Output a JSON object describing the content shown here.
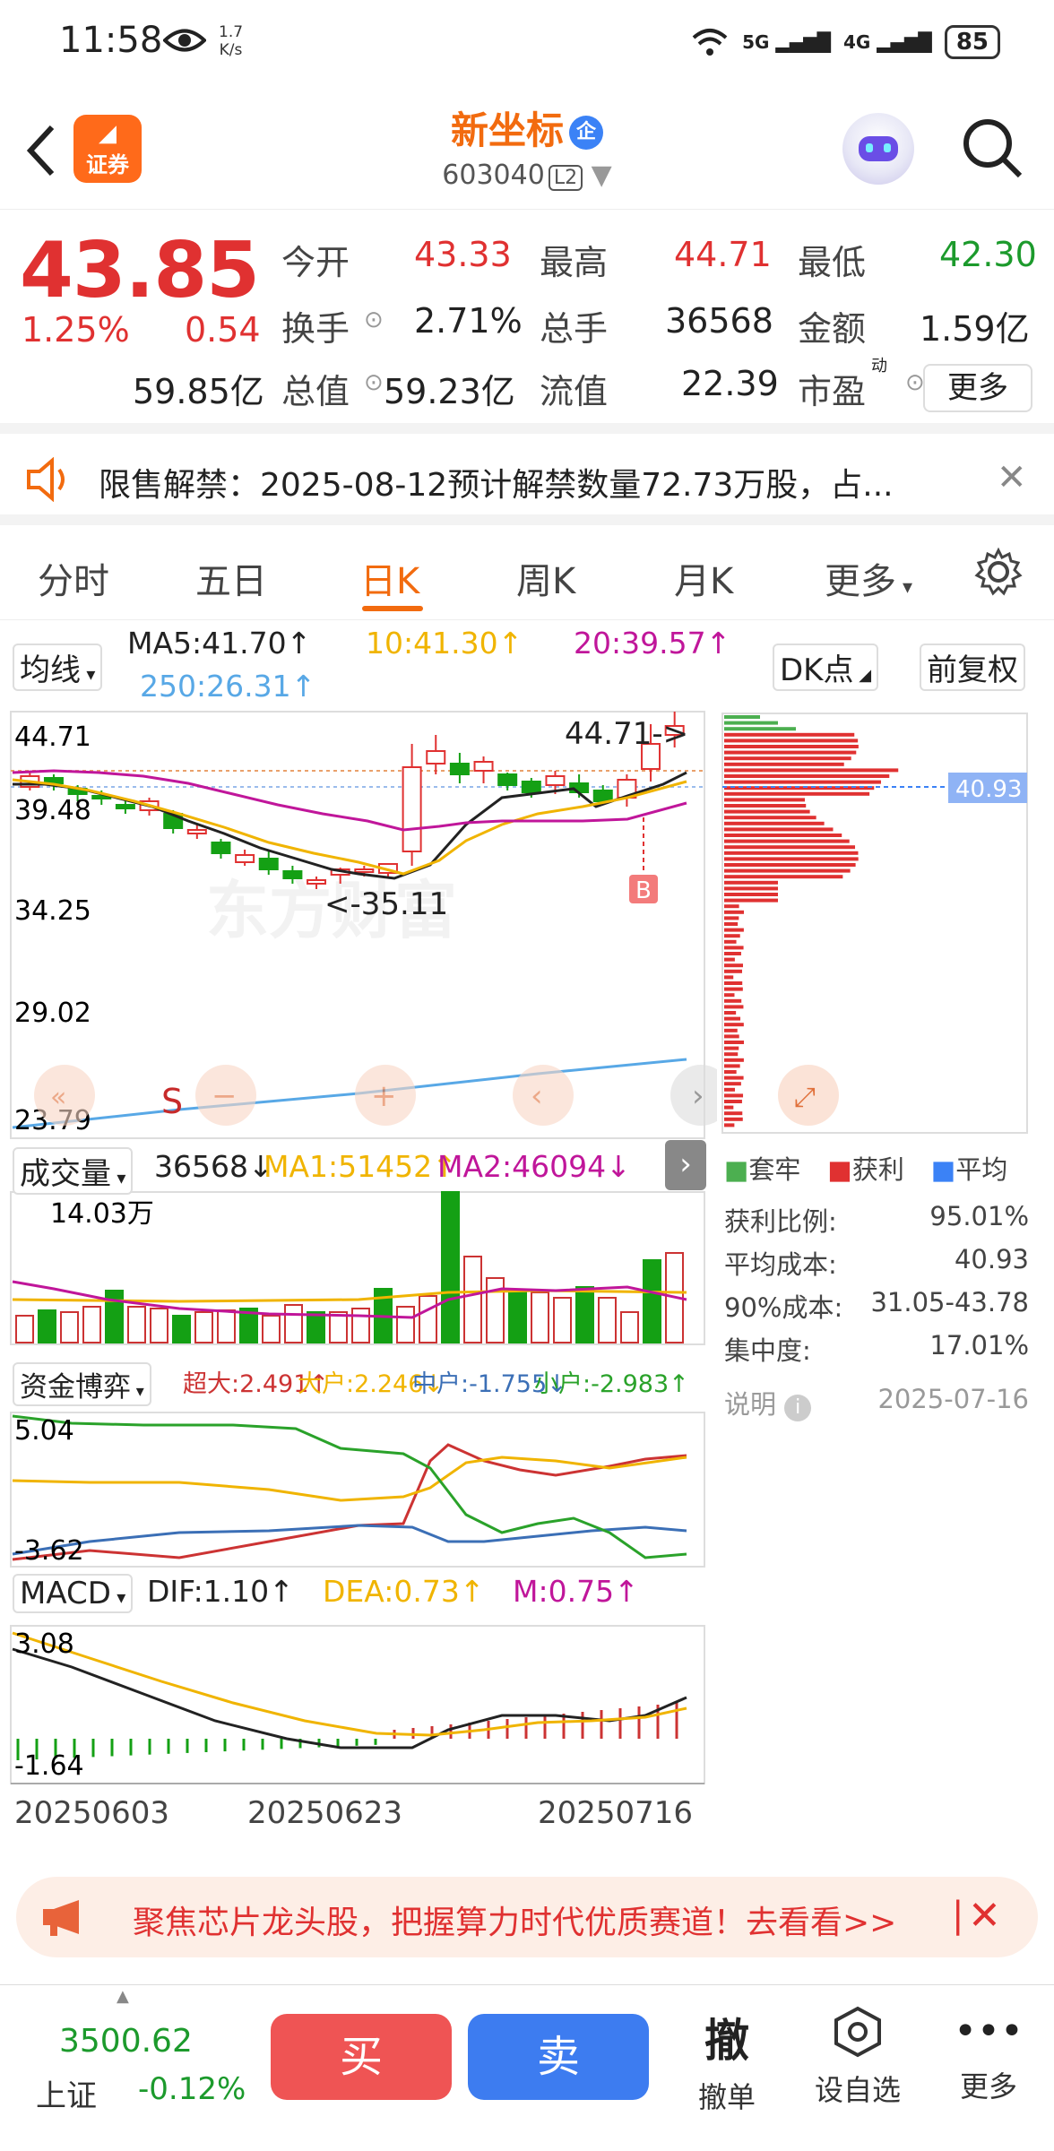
{
  "status": {
    "time": "11:58",
    "speed_num": "1.7",
    "speed_unit": "K/s",
    "sig1": "5G",
    "sig2": "4G",
    "battery": "85"
  },
  "header": {
    "broker": "证券",
    "name": "新坐标",
    "badge": "企",
    "code": "603040",
    "level": "L2"
  },
  "quote": {
    "price": "43.85",
    "pct": "1.25%",
    "change": "0.54",
    "rows": [
      [
        {
          "l": "今开",
          "v": "43.33",
          "c": "red"
        },
        {
          "l": "最高",
          "v": "44.71",
          "c": "red"
        },
        {
          "l": "最低",
          "v": "42.30",
          "c": "green"
        }
      ],
      [
        {
          "l": "换手",
          "v": "2.71%",
          "c": ""
        },
        {
          "l": "总手",
          "v": "36568",
          "c": ""
        },
        {
          "l": "金额",
          "v": "1.59亿",
          "c": ""
        }
      ],
      [
        {
          "l": "总值",
          "v": "59.85亿",
          "c": ""
        },
        {
          "l": "流值",
          "v": "59.23亿",
          "c": ""
        },
        {
          "l": "市盈",
          "v": "22.39",
          "c": ""
        }
      ]
    ],
    "pe_sup": "动",
    "more": "更多"
  },
  "notice": {
    "text": "限售解禁：2025-08-12预计解禁数量72.73万股，占..."
  },
  "tabs": [
    "分时",
    "五日",
    "日K",
    "周K",
    "月K",
    "更多"
  ],
  "kline": {
    "indicator": "均线",
    "ma5": "MA5:41.70↑",
    "ma10": "10:41.30↑",
    "ma20": "20:39.57↑",
    "ma250": "250:26.31↑",
    "dk": "DK点",
    "adjust": "前复权",
    "y_labels": [
      "44.71",
      "39.48",
      "34.25",
      "29.02",
      "23.79"
    ],
    "high_mark": "44.71->",
    "low_mark": "<-35.11",
    "cost_tag": "40.93",
    "buy_tag": "B",
    "sell_tag": "S",
    "watermark": "东方财富"
  },
  "volume": {
    "name": "成交量",
    "val": "36568↓",
    "ma1": "MA1:51452↑",
    "ma2": "MA2:46094↓",
    "y_label": "14.03万"
  },
  "fund": {
    "name": "资金博弈",
    "big": "超大:2.491↑",
    "large": "大户:2.246↓",
    "mid": "中户:-1.755↓",
    "small": "小户:-2.983↑",
    "y_top": "5.04",
    "y_bot": "-3.62"
  },
  "macd": {
    "name": "MACD",
    "dif": "DIF:1.10↑",
    "dea": "DEA:0.73↑",
    "m": "M:0.75↑",
    "y_top": "3.08",
    "y_bot": "-1.64"
  },
  "dates": [
    "20250603",
    "20250623",
    "20250716"
  ],
  "chip": {
    "legend": [
      "套牢",
      "获利",
      "平均"
    ],
    "rows": [
      {
        "l": "获利比例:",
        "v": "95.01%"
      },
      {
        "l": "平均成本:",
        "v": "40.93"
      },
      {
        "l": "90%成本:",
        "v": "31.05-43.78"
      },
      {
        "l": "集中度:",
        "v": "17.01%"
      }
    ],
    "note": "说明",
    "date": "2025-07-16"
  },
  "promo": {
    "text": "聚焦芯片龙头股，把握算力时代优质赛道！去看看>>"
  },
  "footer": {
    "idx_val": "3500.62",
    "idx_name": "上证",
    "idx_pct": "-0.12%",
    "buy": "买",
    "sell": "卖",
    "cancel_icon": "撤",
    "cancel": "撤单",
    "watch": "设自选",
    "more": "更多"
  },
  "colors": {
    "red": "#e03131",
    "green": "#1c9a2c",
    "orange": "#f26b0f",
    "ma10": "#f0b400",
    "ma20": "#c0169a",
    "ma250": "#58a8e6"
  }
}
